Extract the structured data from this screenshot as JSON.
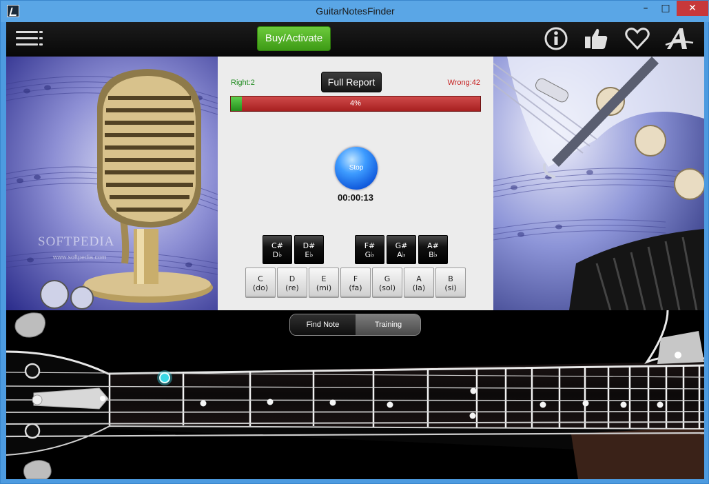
{
  "window": {
    "title": "GuitarNotesFinder",
    "min_label": "–",
    "max_label": "□",
    "close_label": "✕"
  },
  "toolbar": {
    "buy_label": "Buy/Activate",
    "icons": [
      "menu-icon",
      "info-icon",
      "thumbs-up-icon",
      "heart-icon",
      "font-icon"
    ],
    "buy_color": "#4cb021"
  },
  "quiz": {
    "right_label": "Right:2",
    "wrong_label": "Wrong:42",
    "report_label": "Full Report",
    "progress_text": "4%",
    "progress_fraction": 0.045,
    "stop_label": "Stop",
    "timer": "00:00:13"
  },
  "keys": {
    "sharps": [
      {
        "top": "C#",
        "bottom": "D♭"
      },
      {
        "top": "D#",
        "bottom": "E♭"
      },
      {
        "top": "F#",
        "bottom": "G♭"
      },
      {
        "top": "G#",
        "bottom": "A♭"
      },
      {
        "top": "A#",
        "bottom": "B♭"
      }
    ],
    "naturals": [
      {
        "note": "C",
        "solfege": "(do)"
      },
      {
        "note": "D",
        "solfege": "(re)"
      },
      {
        "note": "E",
        "solfege": "(mi)"
      },
      {
        "note": "F",
        "solfege": "(fa)"
      },
      {
        "note": "G",
        "solfege": "(sol)"
      },
      {
        "note": "A",
        "solfege": "(la)"
      },
      {
        "note": "B",
        "solfege": "(si)"
      }
    ]
  },
  "mode_toggle": {
    "find_label": "Find Note",
    "training_label": "Training",
    "selected": "Training"
  },
  "watermark": {
    "brand": "SOFTPEDIA",
    "url": "www.softpedia.com"
  },
  "colors": {
    "titlebar": "#5aa6e6",
    "accent": "#3e9cff",
    "right": "#1d8a1d",
    "wrong": "#c52020",
    "highlight": "#39d8e6"
  }
}
